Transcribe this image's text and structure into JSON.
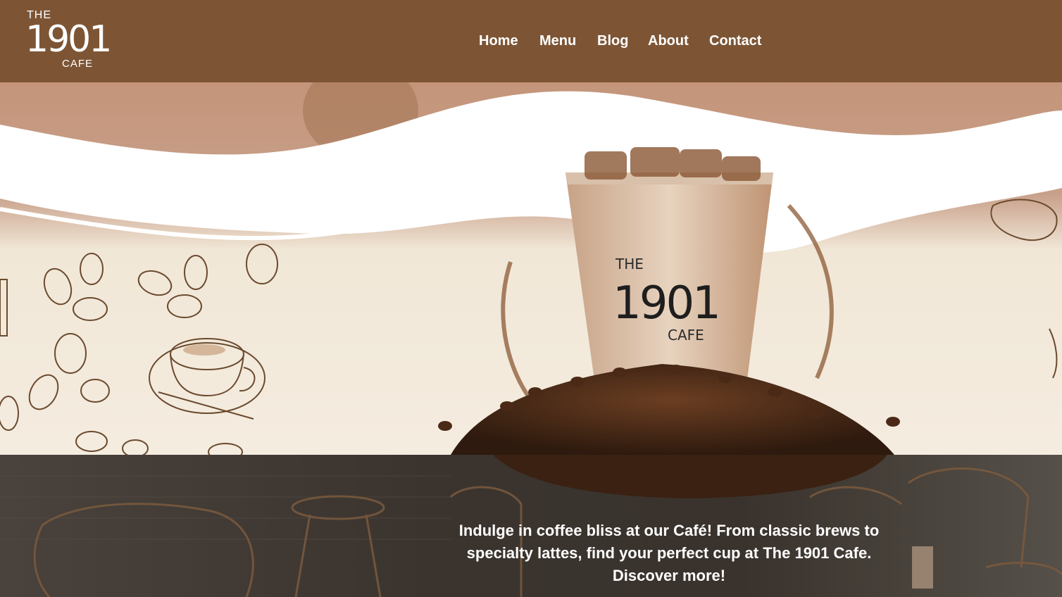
{
  "logo": {
    "top": "THE",
    "number": "1901",
    "bottom": "CAFE"
  },
  "nav": {
    "items": [
      {
        "label": "Home"
      },
      {
        "label": "Menu"
      },
      {
        "label": "Blog"
      },
      {
        "label": "About"
      },
      {
        "label": "Contact"
      }
    ]
  },
  "hero": {
    "cup_logo": {
      "top": "THE",
      "number": "1901",
      "bottom": "CAFE"
    }
  },
  "tagline": "Indulge in coffee bliss at our Café! From classic brews to specialty lattes, find your perfect cup at The 1901 Cafe. Discover more!",
  "colors": {
    "header": "#7d5535",
    "text": "#ffffff",
    "cream": "#f4ecdf"
  }
}
